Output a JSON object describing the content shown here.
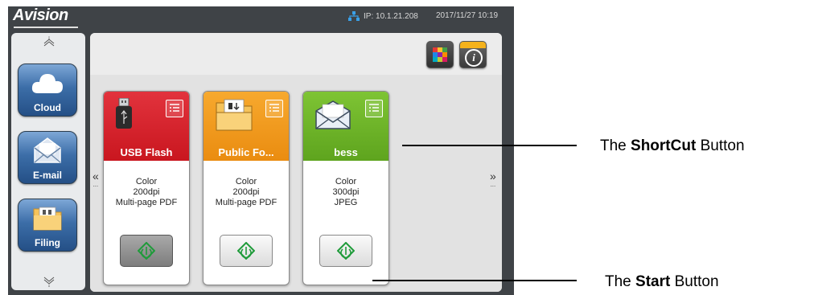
{
  "status": {
    "brand": "Avision",
    "ip": "IP: 10.1.21.208",
    "datetime": "2017/11/27 10:19"
  },
  "sidebar": {
    "items": [
      {
        "label": "Cloud",
        "icon": "cloud-icon"
      },
      {
        "label": "E-mail",
        "icon": "envelope-icon"
      },
      {
        "label": "Filing",
        "icon": "folder-icon"
      }
    ],
    "scroll_up_icon": "chevron-up-icon",
    "scroll_down_icon": "chevron-down-icon"
  },
  "toolbar": {
    "grid_icon": "color-grid-icon",
    "info_icon": "info-icon"
  },
  "navigation": {
    "prev": "«",
    "next": "»"
  },
  "shortcuts": [
    {
      "title": "USB Flash",
      "color": "#d8232d",
      "icon": "usb-drive-icon",
      "color_mode": "Color",
      "resolution": "200dpi",
      "format": "Multi-page PDF",
      "start_pressed": true
    },
    {
      "title": "Public Fo...",
      "color": "#f29a1c",
      "icon": "folder-icon",
      "color_mode": "Color",
      "resolution": "200dpi",
      "format": "Multi-page PDF",
      "start_pressed": false
    },
    {
      "title": "bess",
      "color": "#72b82b",
      "icon": "envelope-icon",
      "color_mode": "Color",
      "resolution": "300dpi",
      "format": "JPEG",
      "start_pressed": false
    }
  ],
  "annotations": {
    "shortcut_prefix": "The ",
    "shortcut_bold": "ShortCut",
    "shortcut_suffix": " Button",
    "start_prefix": "The ",
    "start_bold": "Start",
    "start_suffix": " Button"
  },
  "colors": {
    "screen_bg": "#3f4347",
    "start_icon": "#1f9b3a",
    "accent_yellow": "#f5b21b"
  }
}
